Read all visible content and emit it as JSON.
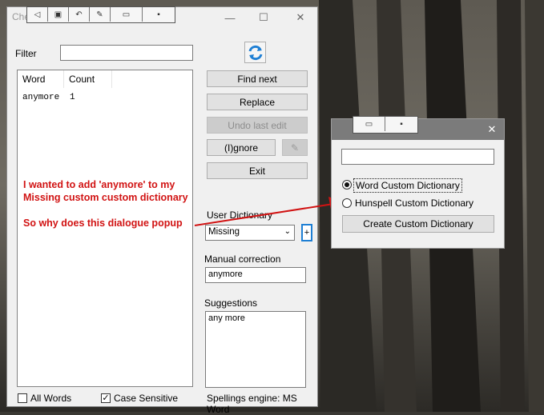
{
  "main_window": {
    "title": "Check Spelling",
    "filter_label": "Filter",
    "filter_value": "",
    "list_columns": [
      "Word",
      "Count"
    ],
    "list_rows": [
      {
        "word": "anymore",
        "count": "1"
      }
    ],
    "buttons": {
      "find_next": "Find next",
      "replace": "Replace",
      "undo_last_edit": "Undo last edit",
      "ignore": "(I)gnore",
      "exit": "Exit",
      "add": "+"
    },
    "user_dictionary_label": "User Dictionary",
    "user_dictionary_value": "Missing",
    "manual_correction_label": "Manual correction",
    "manual_correction_value": "anymore",
    "suggestions_label": "Suggestions",
    "suggestions": [
      "any more"
    ],
    "all_words_label": "All Words",
    "all_words_checked": false,
    "case_sensitive_label": "Case Sensitive",
    "case_sensitive_checked": true,
    "engine_label": "Spellings engine: MS Word"
  },
  "annotation": {
    "line1": "I wanted to add 'anymore' to my",
    "line2": "Missing custom custom dictionary",
    "line3": "So why does this dialogue popup",
    "color": "#d11313"
  },
  "dialog": {
    "input_value": "",
    "options": [
      {
        "label": "Word Custom Dictionary",
        "selected": true
      },
      {
        "label": "Hunspell Custom Dictionary",
        "selected": false
      }
    ],
    "create_button": "Create Custom Dictionary"
  }
}
